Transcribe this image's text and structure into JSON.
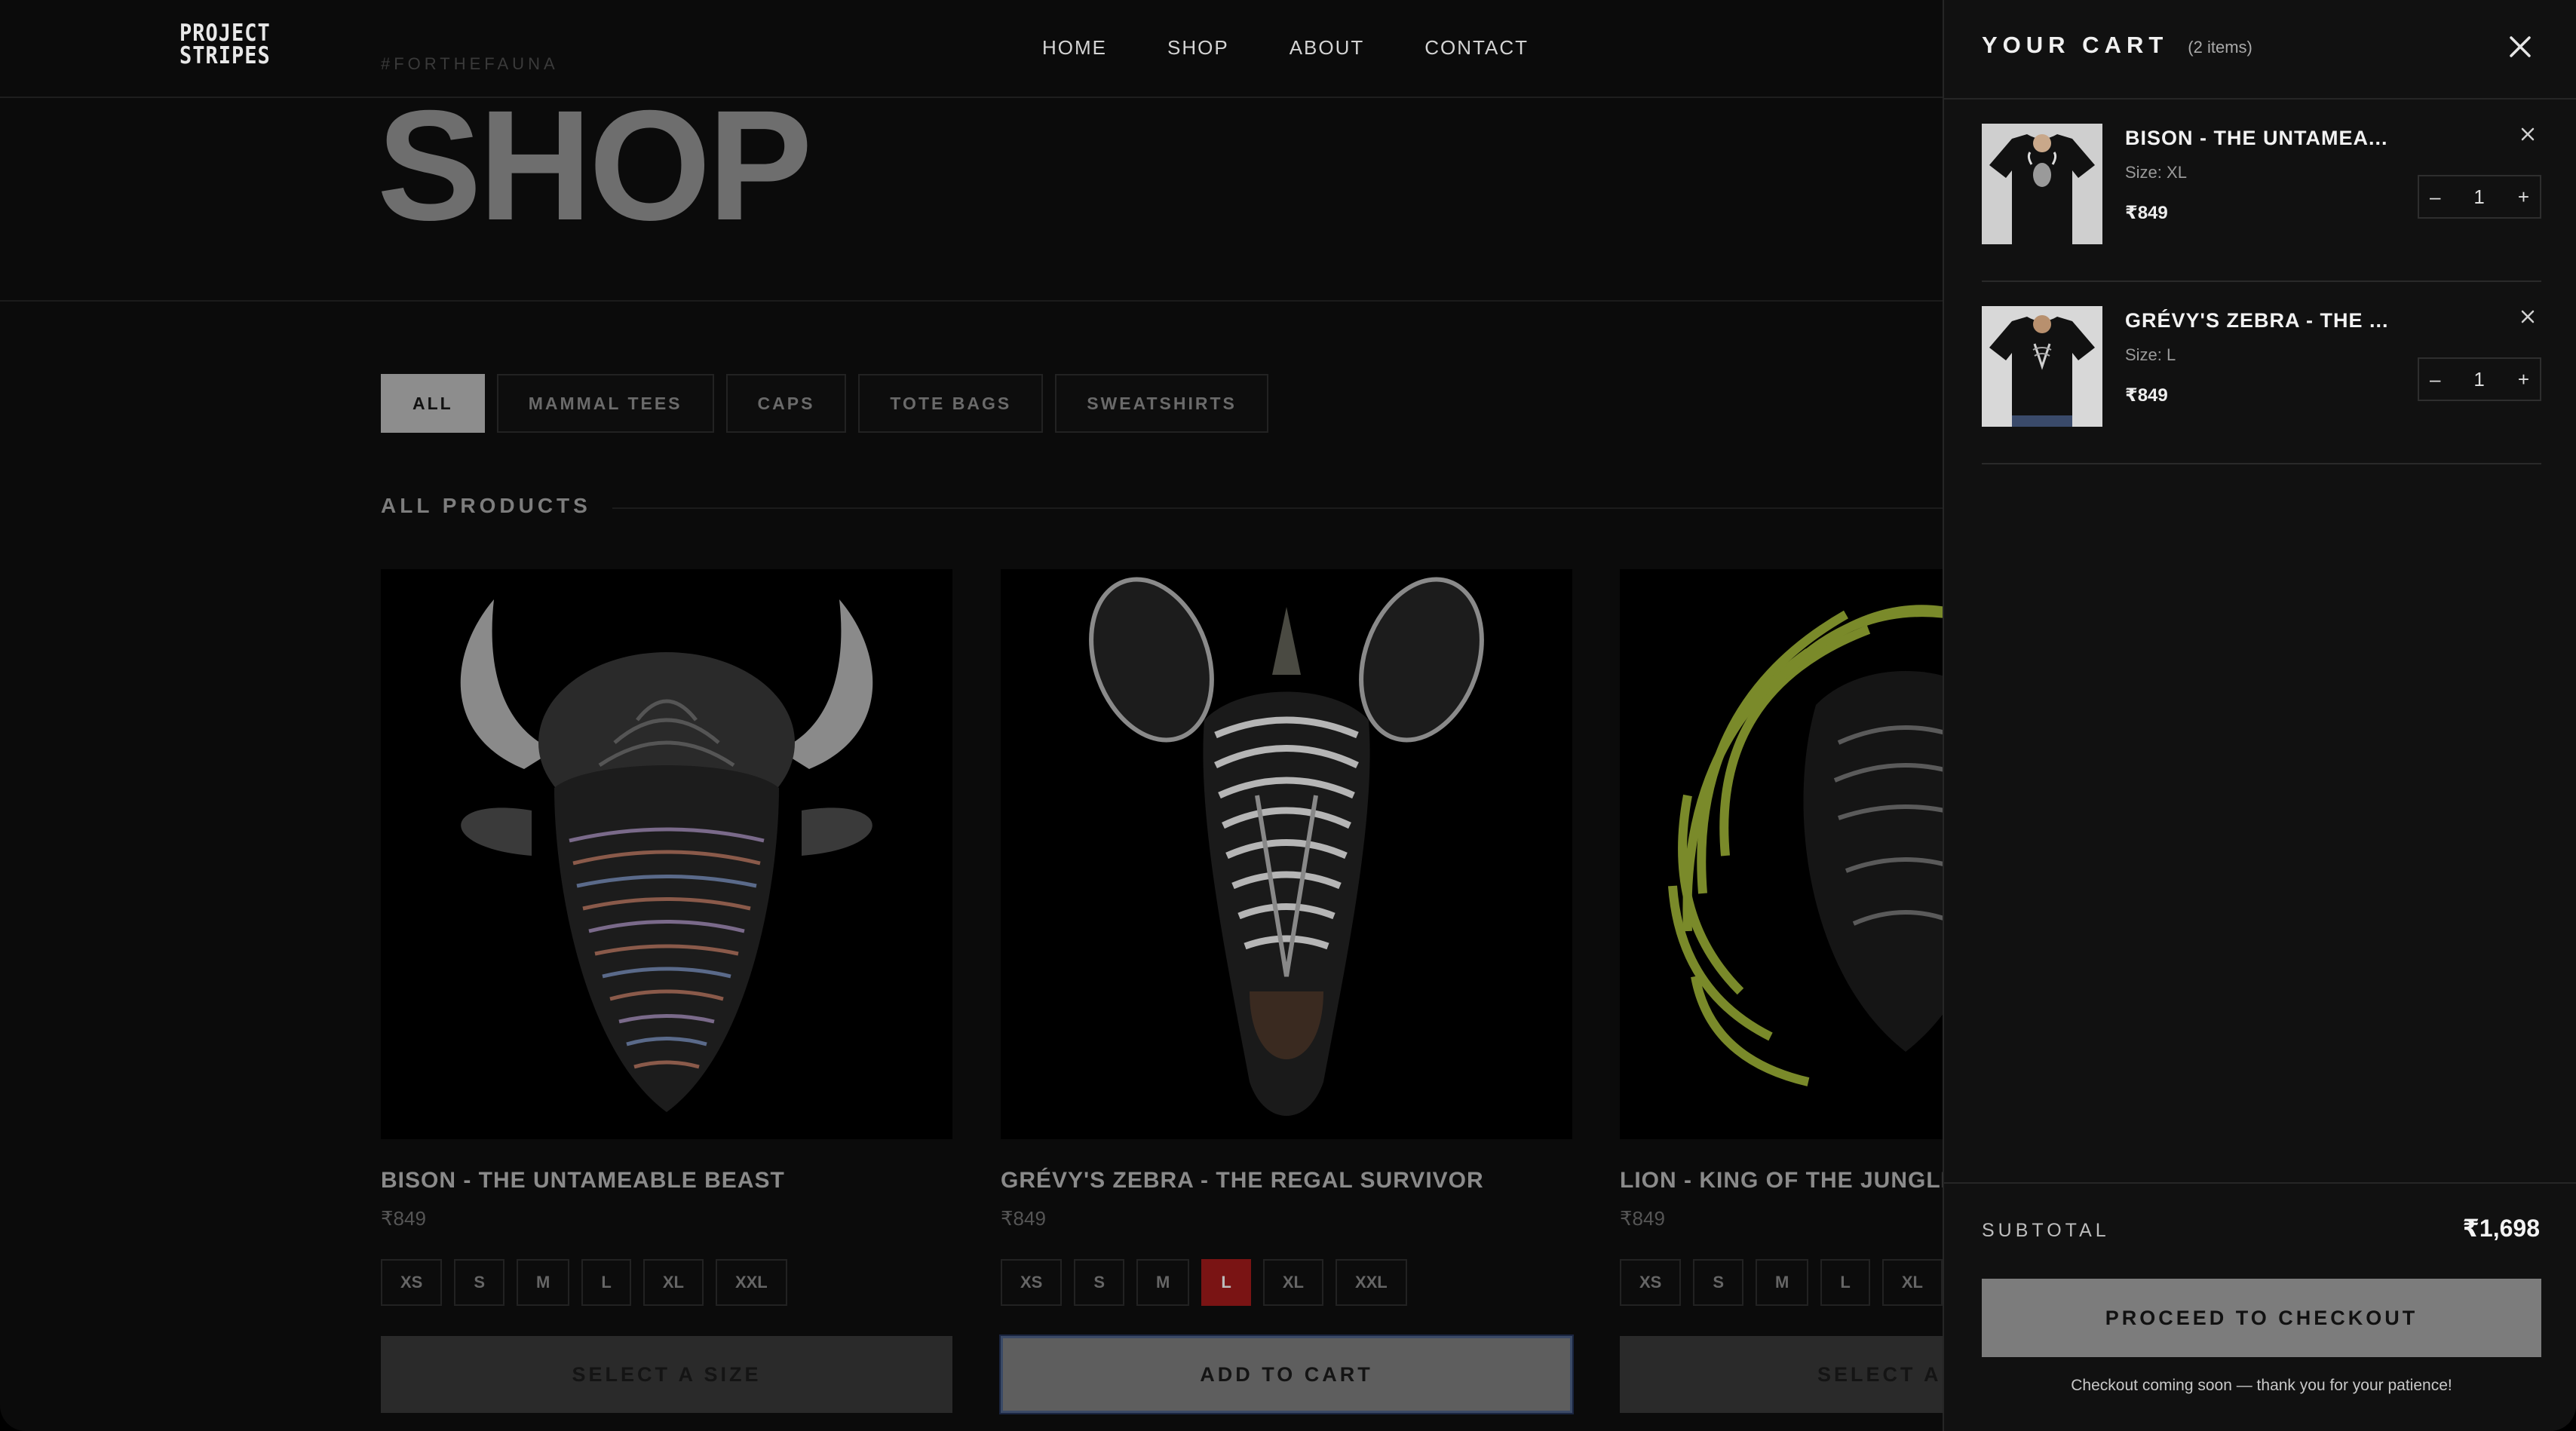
{
  "brand": {
    "logo_line1": "PROJECT",
    "logo_line2": "STRIPES",
    "hashtag": "#FORTHEFAUNA"
  },
  "nav": {
    "home": "HOME",
    "shop": "SHOP",
    "about": "ABOUT",
    "contact": "CONTACT"
  },
  "hero": {
    "title": "SHOP"
  },
  "filters": [
    "ALL",
    "MAMMAL TEES",
    "CAPS",
    "TOTE BAGS",
    "SWEATSHIRTS"
  ],
  "section": {
    "label": "ALL PRODUCTS"
  },
  "products": [
    {
      "title": "BISON - THE UNTAMEABLE BEAST",
      "price": "₹849",
      "sizes": [
        "XS",
        "S",
        "M",
        "L",
        "XL",
        "XXL"
      ],
      "selected_size": "",
      "cta": "SELECT A SIZE"
    },
    {
      "title": "GRÉVY'S ZEBRA - THE REGAL SURVIVOR",
      "price": "₹849",
      "sizes": [
        "XS",
        "S",
        "M",
        "L",
        "XL",
        "XXL"
      ],
      "selected_size": "L",
      "cta": "ADD TO CART"
    },
    {
      "title": "LION - KING OF THE JUNGLE",
      "price": "₹849",
      "sizes": [
        "XS",
        "S",
        "M",
        "L",
        "XL"
      ],
      "selected_size": "",
      "cta": "SELECT A S"
    }
  ],
  "cart": {
    "title": "YOUR CART",
    "count": "(2 items)",
    "items": [
      {
        "title": "BISON - THE UNTAMEA...",
        "size": "Size: XL",
        "price": "₹849",
        "qty": "1"
      },
      {
        "title": "GRÉVY'S ZEBRA - THE ...",
        "size": "Size: L",
        "price": "₹849",
        "qty": "1"
      }
    ],
    "qty_minus": "–",
    "qty_plus": "+",
    "subtotal_label": "SUBTOTAL",
    "subtotal_value": "₹1,698",
    "checkout_label": "PROCEED TO CHECKOUT",
    "note": "Checkout coming soon — thank you for your patience!"
  },
  "colors": {
    "accent_selected_size": "#7a1414",
    "focus_ring": "#3b4a66"
  }
}
